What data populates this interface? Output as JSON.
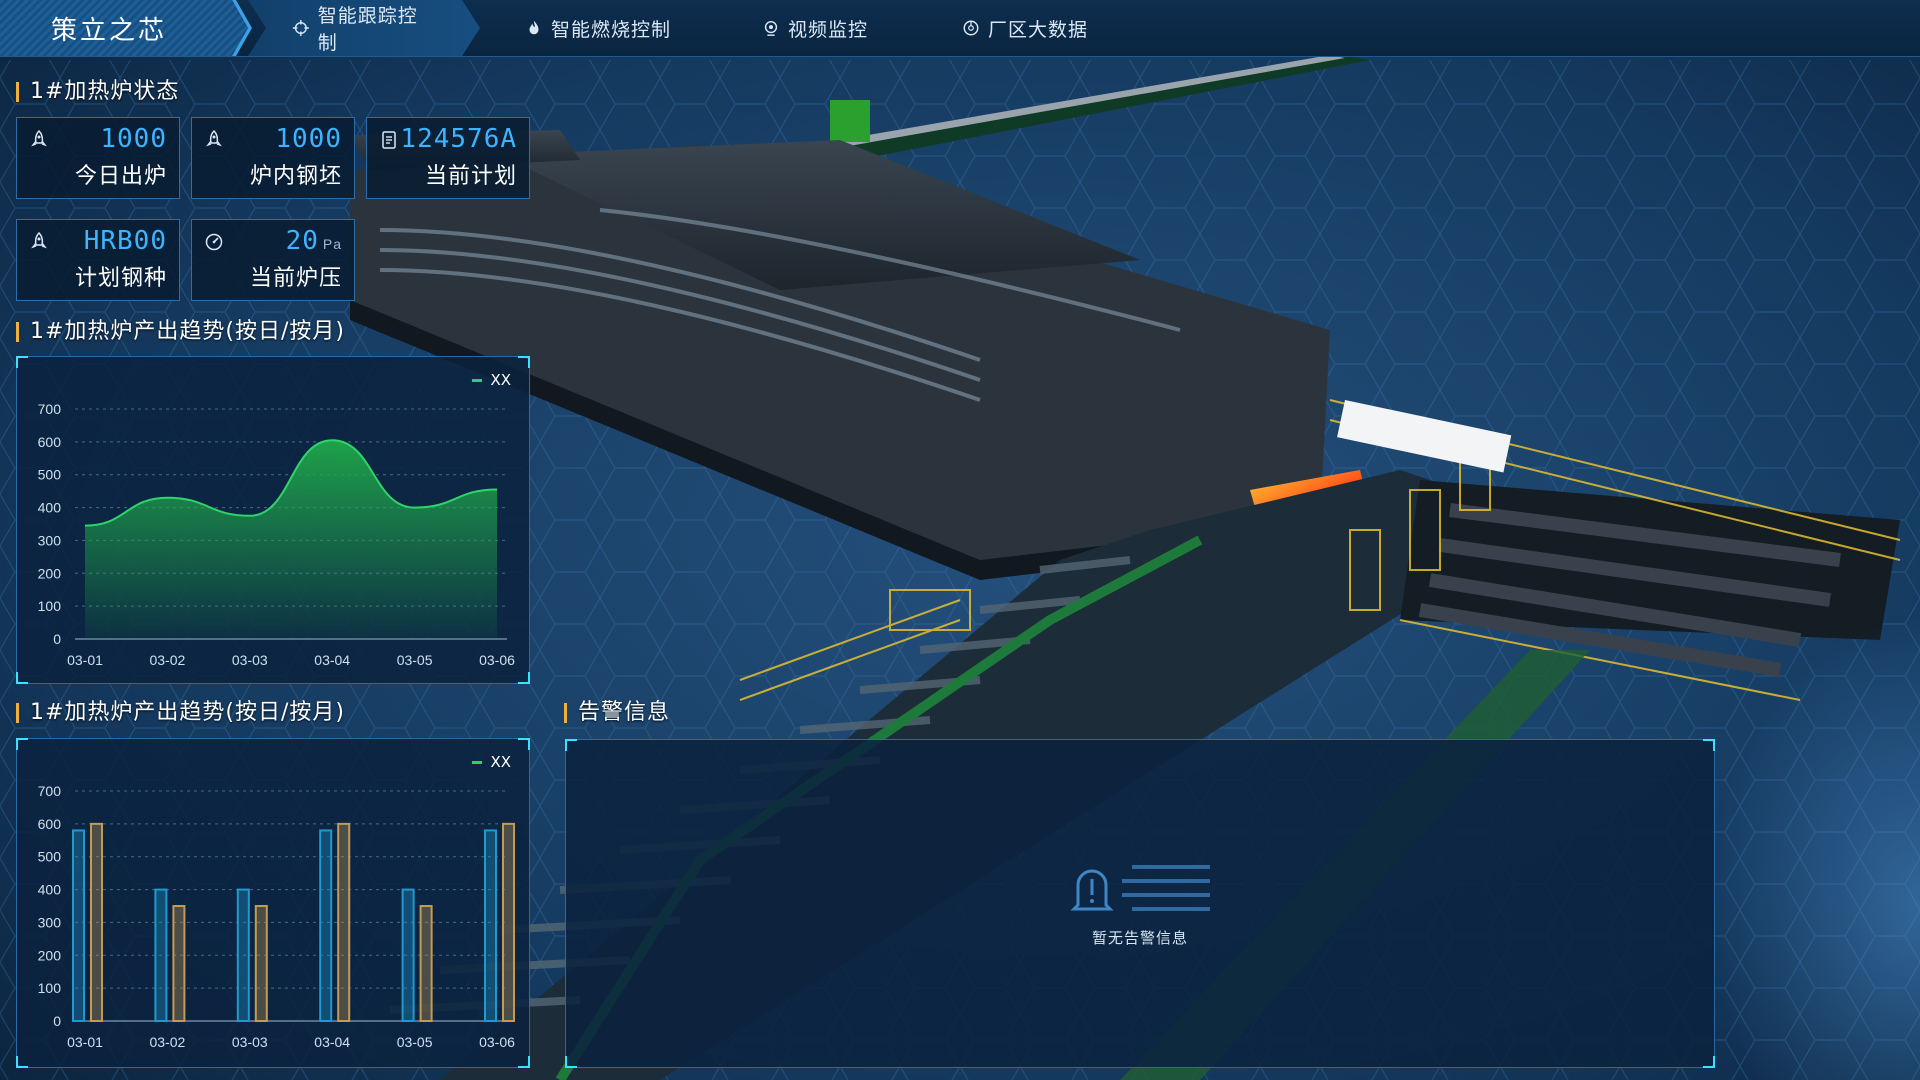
{
  "brand": "策立之芯",
  "nav": [
    {
      "label": "智能跟踪控制",
      "icon": "crosshair-icon"
    },
    {
      "label": "智能燃烧控制",
      "icon": "flame-icon"
    },
    {
      "label": "视频监控",
      "icon": "camera-icon"
    },
    {
      "label": "厂区大数据",
      "icon": "dashboard-icon"
    }
  ],
  "status": {
    "title": "1#加热炉状态",
    "cards": [
      {
        "value": "1000",
        "unit": "",
        "label": "今日出炉",
        "icon": "rocket-icon"
      },
      {
        "value": "1000",
        "unit": "",
        "label": "炉内钢坯",
        "icon": "rocket-icon"
      },
      {
        "value": "124576A",
        "unit": "",
        "label": "当前计划",
        "icon": "document-icon"
      },
      {
        "value": "HRB00",
        "unit": "",
        "label": "计划钢种",
        "icon": "rocket-icon"
      },
      {
        "value": "20",
        "unit": "Pa",
        "label": "当前炉压",
        "icon": "gauge-icon"
      }
    ]
  },
  "trend": {
    "title": "1#加热炉产出趋势(按日/按月)",
    "legend": "XX"
  },
  "trend2": {
    "title": "1#加热炉产出趋势(按日/按月)",
    "legend": "XX"
  },
  "alarm": {
    "title": "告警信息",
    "empty_text": "暂无告警信息"
  },
  "colors": {
    "accent": "#3db4ff",
    "area": "#1fa84a",
    "bar_blue": "#1f9ad0",
    "bar_gold": "#c59a52",
    "corner": "#3fe0ff",
    "heading_mark": "#f0b03a"
  },
  "chart_data": [
    {
      "type": "area",
      "categories": [
        "03-01",
        "03-02",
        "03-03",
        "03-04",
        "03-05",
        "03-06"
      ],
      "series": [
        {
          "name": "XX",
          "values": [
            345,
            430,
            375,
            605,
            400,
            455
          ]
        }
      ],
      "ylim": [
        0,
        700
      ],
      "yticks": [
        0,
        100,
        200,
        300,
        400,
        500,
        600,
        700
      ],
      "grid": true,
      "legend_position": "top-right"
    },
    {
      "type": "bar",
      "categories": [
        "03-01",
        "03-02",
        "03-03",
        "03-04",
        "03-05",
        "03-06"
      ],
      "series": [
        {
          "values": [
            580,
            400,
            400,
            580,
            400,
            580
          ]
        },
        {
          "name": "XX",
          "values": [
            600,
            350,
            350,
            600,
            350,
            600
          ]
        }
      ],
      "ylim": [
        0,
        700
      ],
      "yticks": [
        0,
        100,
        200,
        300,
        400,
        500,
        600,
        700
      ],
      "grid": true,
      "legend_position": "top-right"
    }
  ]
}
